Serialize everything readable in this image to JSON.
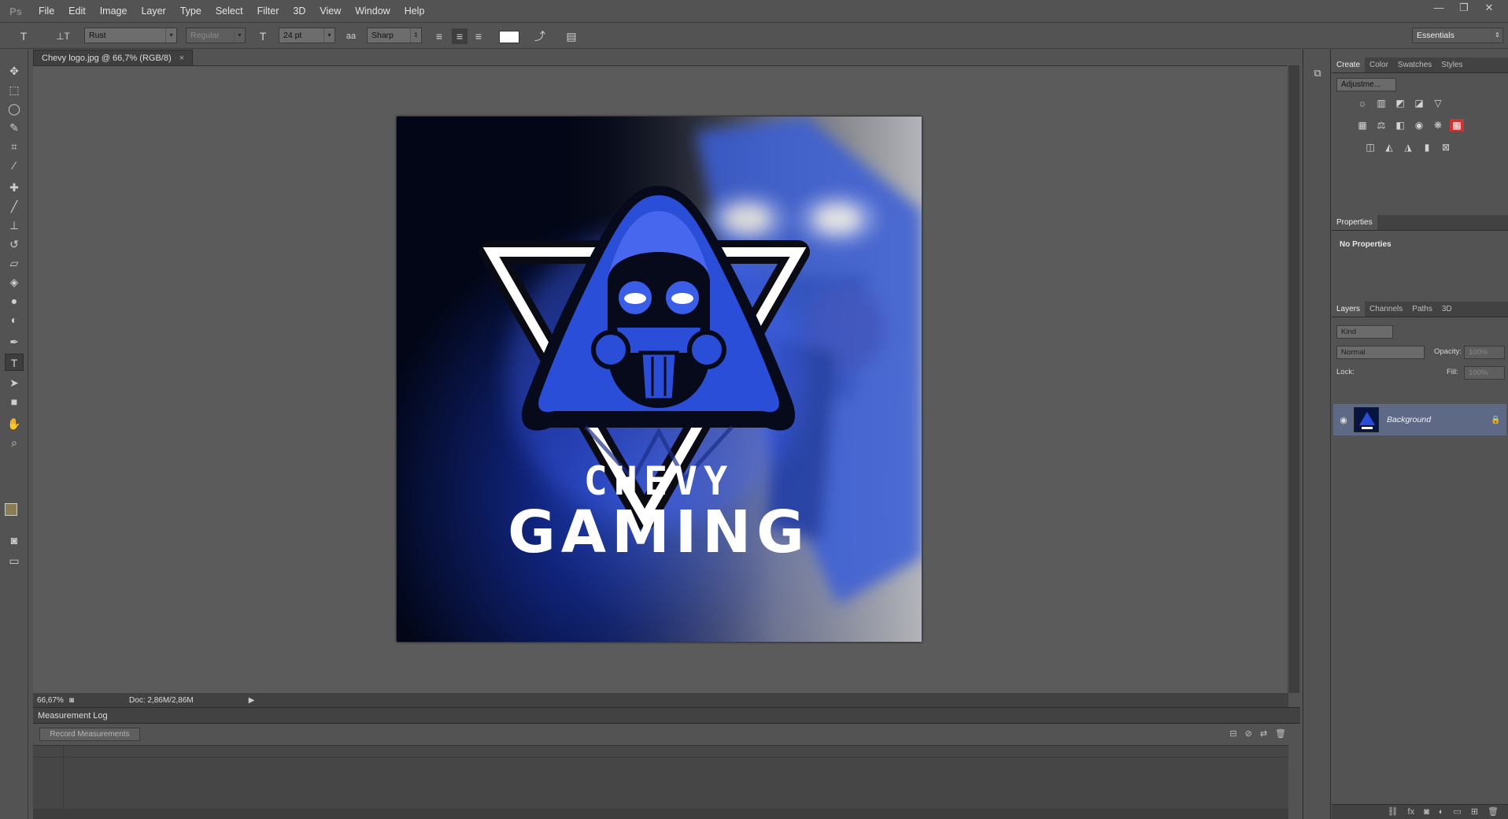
{
  "app": {
    "logo": "Ps"
  },
  "menu": [
    "File",
    "Edit",
    "Image",
    "Layer",
    "Type",
    "Select",
    "Filter",
    "3D",
    "View",
    "Window",
    "Help"
  ],
  "window_controls": [
    "—",
    "❐",
    "✕"
  ],
  "options": {
    "font_family": "Rust",
    "font_style": "Regular",
    "font_size": "24 pt",
    "antialias": "Sharp",
    "workspace": "Essentials"
  },
  "document": {
    "tab_title": "Chevy logo.jpg @ 66,7% (RGB/8)",
    "close": "×",
    "artwork_line1": "CHEVY",
    "artwork_line2": "GAMING"
  },
  "status": {
    "zoom": "66,67%",
    "doc": "Doc: 2,86M/2,86M"
  },
  "measurement_log": {
    "title": "Measurement Log",
    "record_button": "Record Measurements"
  },
  "panels": {
    "top_tabs": [
      "Create",
      "Color",
      "Swatches",
      "Styles"
    ],
    "adjustments_select": "Adjustme...",
    "properties_title": "Properties",
    "no_properties": "No Properties",
    "layer_tabs": [
      "Layers",
      "Channels",
      "Paths",
      "3D"
    ],
    "kind": "Kind",
    "blend_mode": "Normal",
    "opacity_label": "Opacity:",
    "opacity_value": "100%",
    "lock_label": "Lock:",
    "fill_label": "Fill:",
    "fill_value": "100%",
    "layer_name": "Background"
  },
  "colors": {
    "accent_blue": "#2a4fd6",
    "selected_layer": "#5e6a85"
  }
}
